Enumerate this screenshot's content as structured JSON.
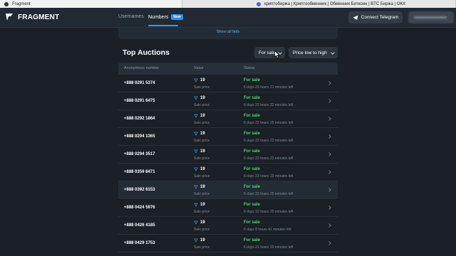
{
  "browser": {
    "tabs": [
      {
        "title": "Fragment"
      },
      {
        "title": "криптобиржа | Криптообменник | Обменник Биткоин | BTC Биржа | ОКХ"
      }
    ]
  },
  "header": {
    "logo_text": "FRAGMENT",
    "nav": [
      {
        "label": "Usernames",
        "active": false
      },
      {
        "label": "Numbers",
        "active": true,
        "badge": "New"
      }
    ],
    "connect_label": "Connect Telegram"
  },
  "bids": {
    "show_all_label": "Show all bids"
  },
  "auctions": {
    "title": "Top Auctions",
    "filter_label": "For sale",
    "sort_label": "Price low to high",
    "columns": [
      "Anonymous number",
      "Value",
      "Status"
    ],
    "rows": [
      {
        "number": "+888 0291 5374",
        "price": "19",
        "price_note": "Sale price",
        "status": "For sale",
        "time": "6 days 23 hours 21 minutes left"
      },
      {
        "number": "+888 0291 6475",
        "price": "19",
        "price_note": "Sale price",
        "status": "For sale",
        "time": "6 days 23 hours 22 minutes left"
      },
      {
        "number": "+888 0292 1864",
        "price": "19",
        "price_note": "Sale price",
        "status": "For sale",
        "time": "6 days 22 hours 25 minutes left"
      },
      {
        "number": "+888 0294 1365",
        "price": "19",
        "price_note": "Sale price",
        "status": "For sale",
        "time": "6 days 23 hours 23 minutes left"
      },
      {
        "number": "+888 0294 3517",
        "price": "19",
        "price_note": "Sale price",
        "status": "For sale",
        "time": "6 days 23 hours 23 minutes left"
      },
      {
        "number": "+888 0359 8471",
        "price": "19",
        "price_note": "Sale price",
        "status": "For sale",
        "time": "6 days 23 hours 19 minutes left"
      },
      {
        "number": "+888 0392 6153",
        "price": "19",
        "price_note": "Sale price",
        "status": "For sale",
        "time": "6 days 23 hours 20 minutes left"
      },
      {
        "number": "+888 0424 5976",
        "price": "19",
        "price_note": "Sale price",
        "status": "For sale",
        "time": "6 days 10 hours 20 minutes left"
      },
      {
        "number": "+888 0426 4185",
        "price": "19",
        "price_note": "Sale price",
        "status": "For sale",
        "time": "6 days 8 hours 41 minutes left"
      },
      {
        "number": "+888 0429 1753",
        "price": "19",
        "price_note": "Sale price",
        "status": "For sale",
        "time": "6 days 21 hours 19 minutes left"
      }
    ],
    "highlighted_row": 6
  },
  "colors": {
    "background": "#1a2026",
    "accent": "#2d9cf0",
    "status_green": "#4ad76b",
    "ton_blue": "#3b9ff5"
  },
  "icons": {
    "logo": "fragment-logo-icon",
    "connect": "telegram-icon",
    "price": "ton-icon",
    "row_arrow": "chevron-right-icon"
  }
}
